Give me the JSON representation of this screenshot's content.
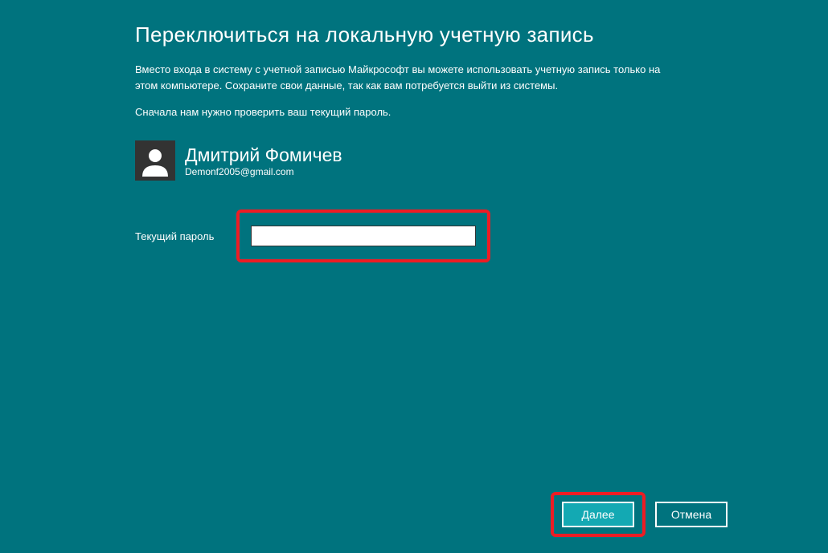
{
  "title": "Переключиться на локальную учетную запись",
  "description": "Вместо входа в систему с учетной записью Майкрософт вы можете использовать учетную запись только на этом компьютере. Сохраните свои данные, так как вам потребуется выйти из системы.",
  "subdescription": "Сначала нам нужно проверить ваш текущий пароль.",
  "user": {
    "name": "Дмитрий Фомичев",
    "email": "Demonf2005@gmail.com"
  },
  "password": {
    "label": "Текущий пароль",
    "value": ""
  },
  "buttons": {
    "next": "Далее",
    "cancel": "Отмена"
  },
  "highlight_color": "#ed1c24"
}
